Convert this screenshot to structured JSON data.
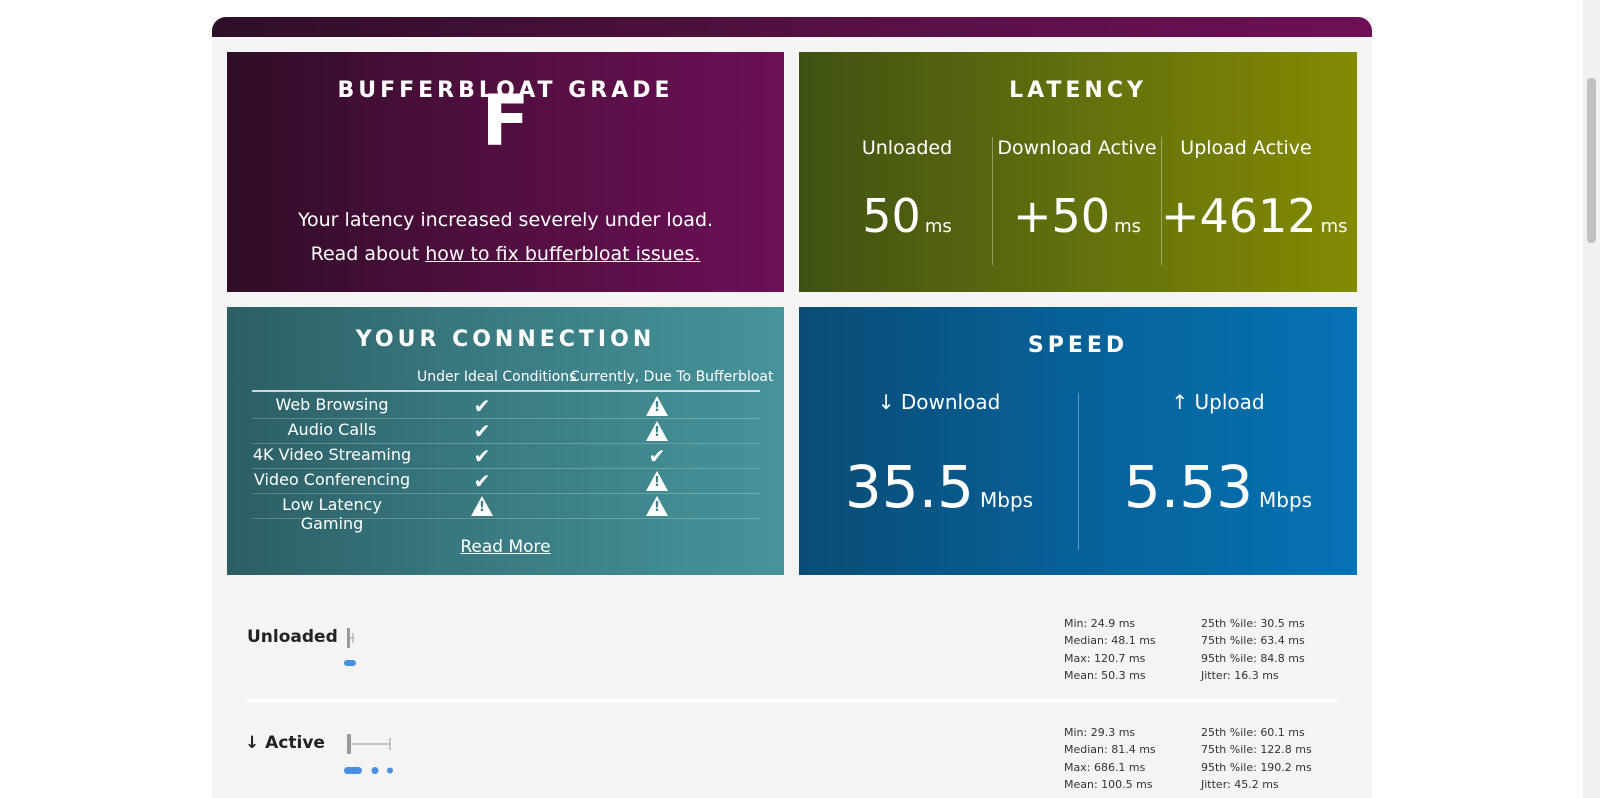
{
  "grade": {
    "title": "BUFFERBLOAT GRADE",
    "letter": "F",
    "message": "Your latency increased severely under load.",
    "read_prefix": "Read about ",
    "link_text": "how to fix bufferbloat issues."
  },
  "latency": {
    "title": "LATENCY",
    "columns": [
      {
        "label": "Unloaded",
        "value": "50",
        "unit": "ms"
      },
      {
        "label": "Download Active",
        "value": "+50",
        "unit": "ms"
      },
      {
        "label": "Upload Active",
        "value": "+4612",
        "unit": "ms"
      }
    ]
  },
  "connection": {
    "title": "YOUR CONNECTION",
    "col_ideal": "Under Ideal Conditions",
    "col_current": "Currently, Due To Bufferbloat",
    "rows": [
      {
        "name": "Web Browsing",
        "ideal": "check",
        "current": "warning"
      },
      {
        "name": "Audio Calls",
        "ideal": "check",
        "current": "warning"
      },
      {
        "name": "4K Video Streaming",
        "ideal": "check",
        "current": "check"
      },
      {
        "name": "Video Conferencing",
        "ideal": "check",
        "current": "warning"
      },
      {
        "name": "Low Latency Gaming",
        "ideal": "warning",
        "current": "warning"
      }
    ],
    "read_more": "Read More"
  },
  "speed": {
    "title": "SPEED",
    "download": {
      "label": "↓ Download",
      "value": "35.5",
      "unit": "Mbps"
    },
    "upload": {
      "label": "↑ Upload",
      "value": "5.53",
      "unit": "Mbps"
    }
  },
  "stats": {
    "unloaded": {
      "label": "Unloaded",
      "left": [
        "Min: 24.9 ms",
        "Median: 48.1 ms",
        "Max: 120.7 ms",
        "Mean: 50.3 ms"
      ],
      "right": [
        "25th %ile: 30.5 ms",
        "75th %ile: 63.4 ms",
        "95th %ile: 84.8 ms",
        "Jitter: 16.3 ms"
      ]
    },
    "down_active": {
      "label": "↓ Active",
      "left": [
        "Min: 29.3 ms",
        "Median: 81.4 ms",
        "Max: 686.1 ms",
        "Mean: 100.5 ms"
      ],
      "right": [
        "25th %ile: 60.1 ms",
        "75th %ile: 122.8 ms",
        "95th %ile: 190.2 ms",
        "Jitter: 45.2 ms"
      ]
    }
  },
  "colors": {
    "grade_bg": "#5a1046",
    "latency_bg": "#5f6d0e",
    "connection_bg": "#397a81",
    "speed_bg": "#075f95",
    "accent_blue": "#4a90e2"
  }
}
